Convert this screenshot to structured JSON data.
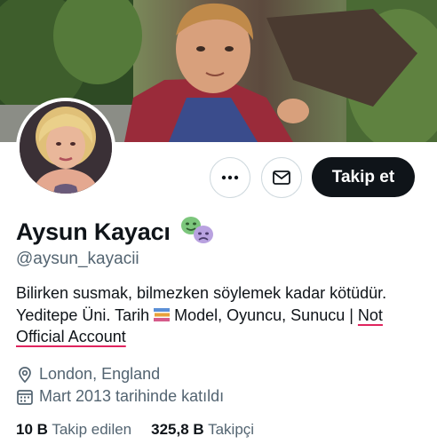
{
  "profile": {
    "display_name": "Aysun Kayacı",
    "handle": "@aysun_kayacii",
    "bio_line1": "Bilirken susmak, bilmezken söylemek kadar kötüdür.",
    "bio_line2_a": "Yeditepe Üni. Tarih",
    "bio_line2_b": "Model, Oyuncu, Sunucu |",
    "bio_line2_c": "Not",
    "bio_line3": "Official Account",
    "location": "London, England",
    "joined": "Mart 2013 tarihinde katıldı"
  },
  "actions": {
    "follow_label": "Takip et",
    "more_icon": "more-horizontal-icon",
    "message_icon": "envelope-icon"
  },
  "stats": {
    "following_count": "10 B",
    "following_label": "Takip edilen",
    "followers_count": "325,8 B",
    "followers_label": "Takipçi"
  },
  "colors": {
    "follow_bg": "#0f1419",
    "secondary_text": "#536471",
    "annotation_underline": "#e0245e"
  }
}
